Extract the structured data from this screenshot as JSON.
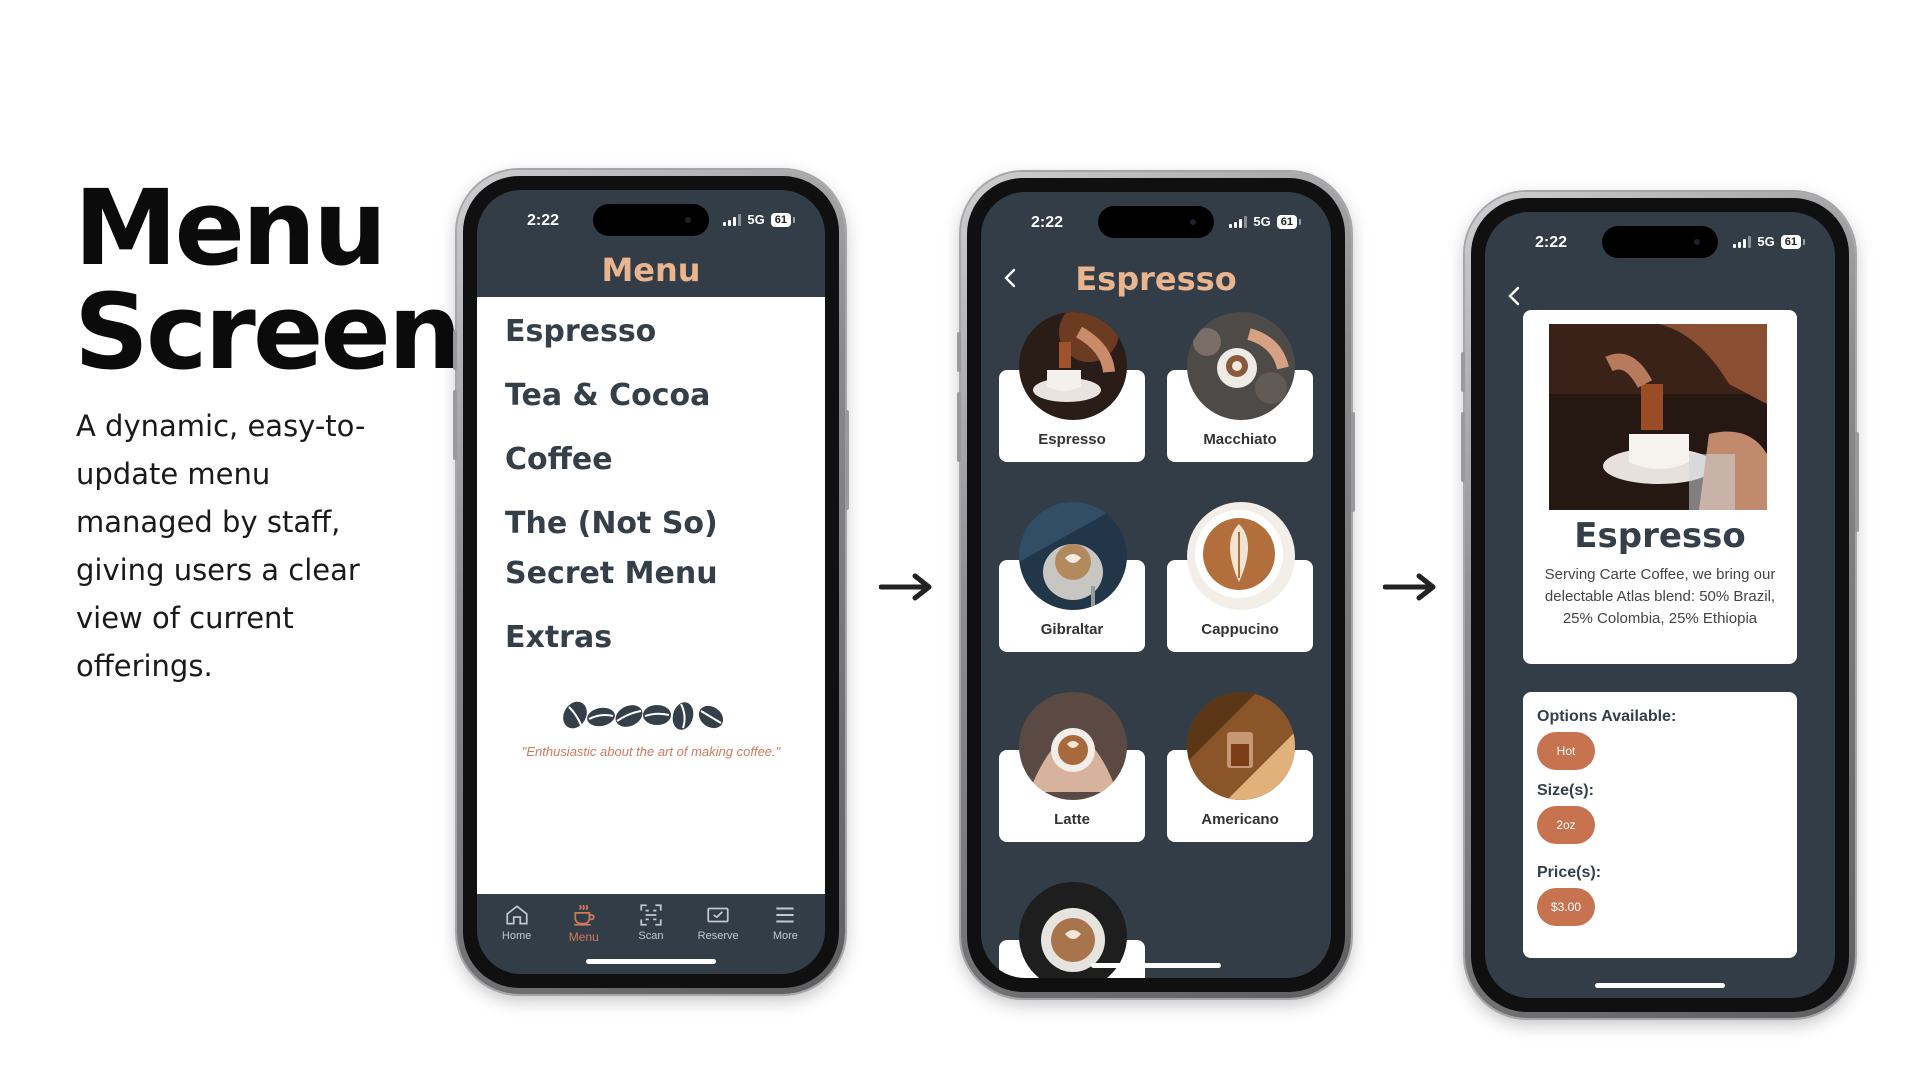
{
  "slide": {
    "title_line1": "Menu",
    "title_line2": "Screens",
    "description": "A dynamic, easy-to-update menu managed by staff, giving users a clear view of current offerings."
  },
  "status": {
    "time": "2:22",
    "network": "5G",
    "battery": "61"
  },
  "phone1": {
    "header": "Menu",
    "categories": [
      "Espresso",
      "Tea & Cocoa",
      "Coffee",
      "The (Not So) Secret Menu",
      "Extras"
    ],
    "tagline": "\"Enthusiastic about the art of making coffee.\"",
    "tabs": [
      {
        "label": "Home",
        "icon": "home-icon"
      },
      {
        "label": "Menu",
        "icon": "coffee-cup-icon"
      },
      {
        "label": "Scan",
        "icon": "scan-icon"
      },
      {
        "label": "Reserve",
        "icon": "reserve-icon"
      },
      {
        "label": "More",
        "icon": "hamburger-icon"
      }
    ],
    "active_tab": "Menu"
  },
  "phone2": {
    "title": "Espresso",
    "items": [
      "Espresso",
      "Macchiato",
      "Gibraltar",
      "Cappucino",
      "Latte",
      "Americano"
    ]
  },
  "phone3": {
    "title": "Espresso",
    "description": "Serving Carte Coffee, we bring our delectable Atlas blend: 50% Brazil, 25% Colombia, 25% Ethiopia",
    "options_label": "Options Available:",
    "options": [
      "Hot"
    ],
    "sizes_label": "Size(s):",
    "sizes": [
      "2oz"
    ],
    "prices_label": "Price(s):",
    "prices": [
      "$3.00"
    ]
  },
  "colors": {
    "app_dark": "#323d47",
    "accent_peach": "#e9b48e",
    "accent_terracotta": "#c8734f"
  }
}
